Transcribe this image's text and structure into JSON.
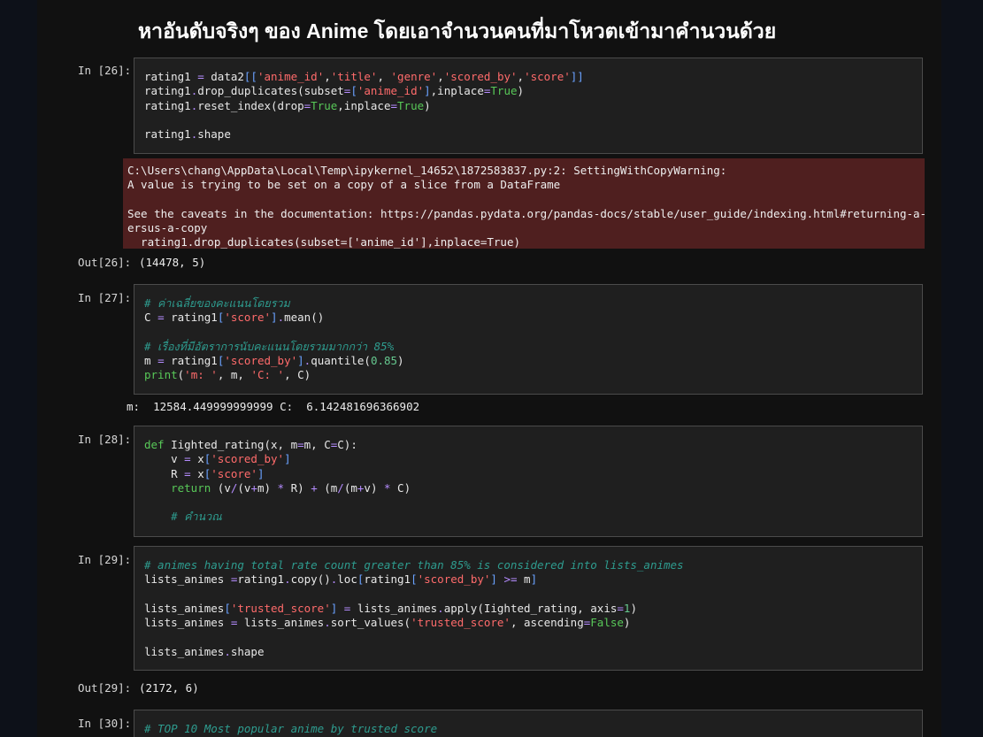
{
  "heading": "หาอันดับจริงๆ ของ Anime โดยเอาจำนวนคนที่มาโหวตเข้ามาคำนวนด้วย",
  "cells": {
    "c26": {
      "in_prompt": "In [26]:",
      "out_prompt": "Out[26]:",
      "output": "(14478, 5)",
      "warning": [
        "C:\\Users\\chang\\AppData\\Local\\Temp\\ipykernel_14652\\1872583837.py:2: SettingWithCopyWarning:",
        "A value is trying to be set on a copy of a slice from a DataFrame",
        "",
        "See the caveats in the documentation: https://pandas.pydata.org/pandas-docs/stable/user_guide/indexing.html#returning-a-view-v",
        "ersus-a-copy",
        "  rating1.drop_duplicates(subset=['anime_id'],inplace=True)"
      ]
    },
    "c27": {
      "in_prompt": "In [27]:",
      "output": "m:  12584.449999999999 C:  6.142481696366902"
    },
    "c28": {
      "in_prompt": "In [28]:"
    },
    "c29": {
      "in_prompt": "In [29]:",
      "out_prompt": "Out[29]:",
      "output": "(2172, 6)"
    },
    "c30": {
      "in_prompt": "In [30]:"
    }
  }
}
